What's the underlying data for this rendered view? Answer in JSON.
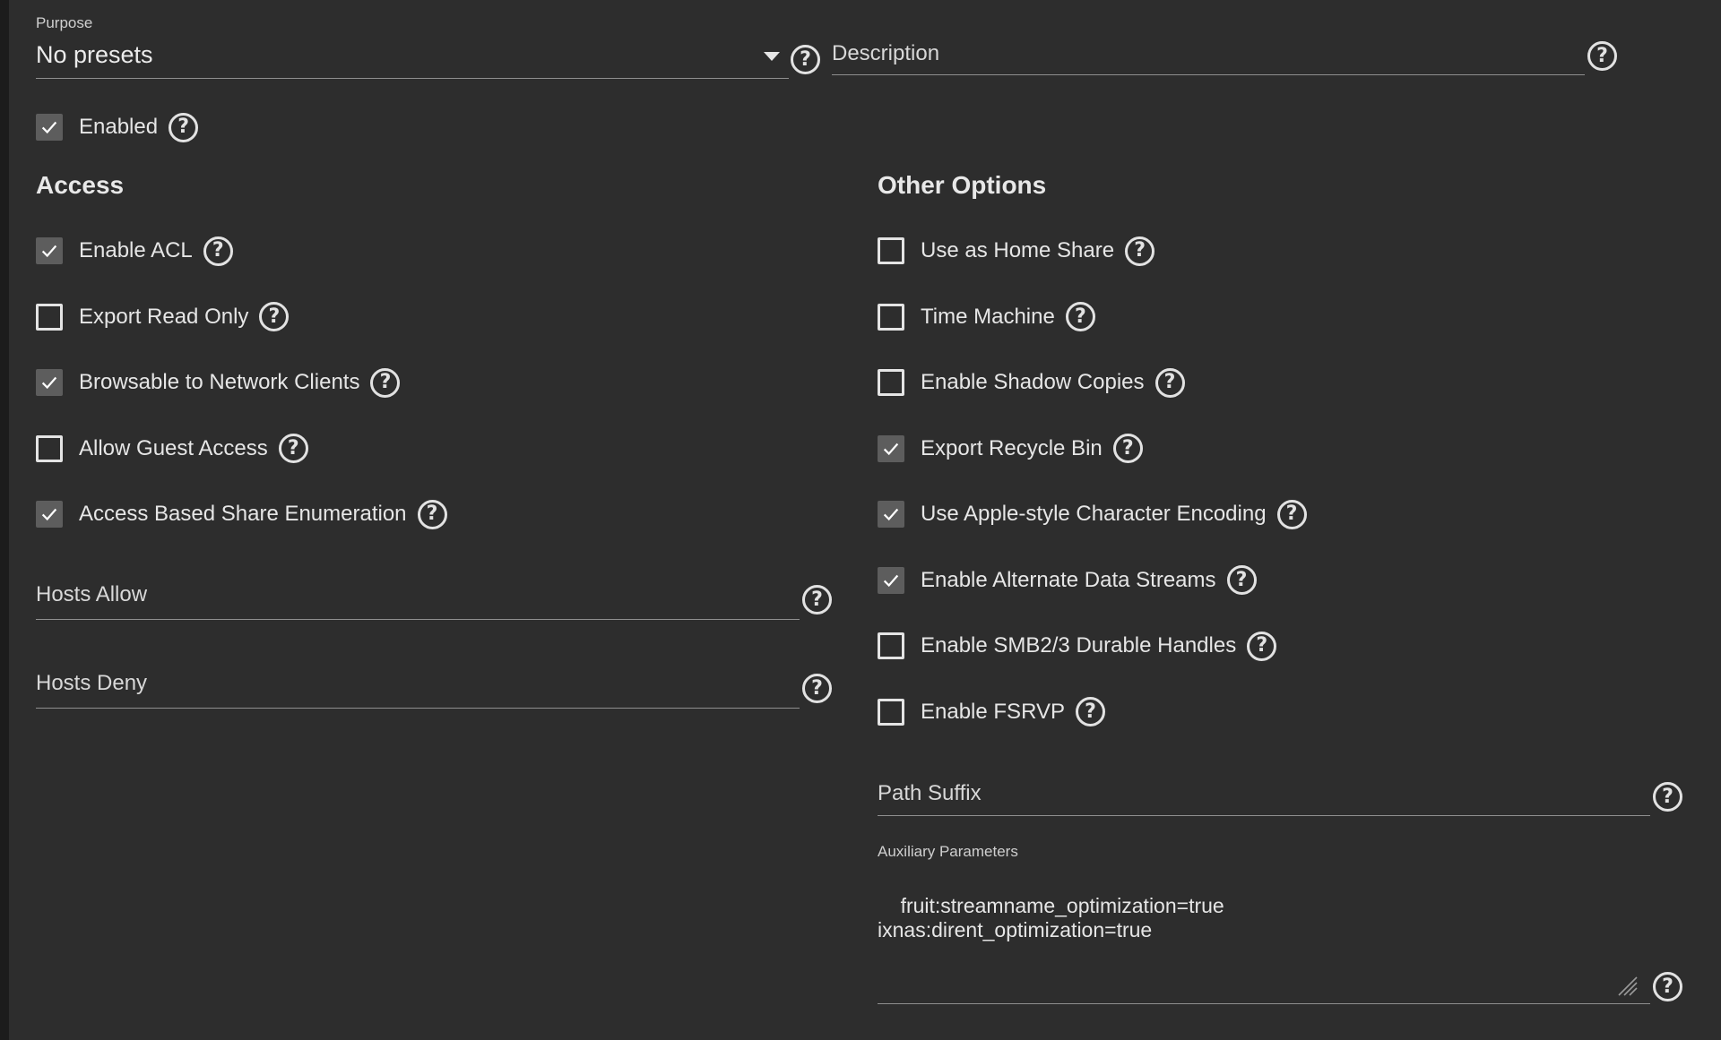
{
  "purpose": {
    "label": "Purpose",
    "value": "No presets"
  },
  "description": {
    "placeholder": "Description"
  },
  "enabled": {
    "label": "Enabled",
    "checked": true
  },
  "access": {
    "title": "Access",
    "options": [
      {
        "label": "Enable ACL",
        "checked": true
      },
      {
        "label": "Export Read Only",
        "checked": false
      },
      {
        "label": "Browsable to Network Clients",
        "checked": true
      },
      {
        "label": "Allow Guest Access",
        "checked": false
      },
      {
        "label": "Access Based Share Enumeration",
        "checked": true
      }
    ],
    "hosts_allow": {
      "placeholder": "Hosts Allow"
    },
    "hosts_deny": {
      "placeholder": "Hosts Deny"
    }
  },
  "other": {
    "title": "Other Options",
    "options": [
      {
        "label": "Use as Home Share",
        "checked": false
      },
      {
        "label": "Time Machine",
        "checked": false
      },
      {
        "label": "Enable Shadow Copies",
        "checked": false
      },
      {
        "label": "Export Recycle Bin",
        "checked": true
      },
      {
        "label": "Use Apple-style Character Encoding",
        "checked": true
      },
      {
        "label": "Enable Alternate Data Streams",
        "checked": true
      },
      {
        "label": "Enable SMB2/3 Durable Handles",
        "checked": false
      },
      {
        "label": "Enable FSRVP",
        "checked": false
      }
    ],
    "path_suffix": {
      "placeholder": "Path Suffix"
    },
    "aux": {
      "label": "Auxiliary Parameters",
      "value": "fruit:streamname_optimization=true\nixnas:dirent_optimization=true"
    }
  },
  "colors": {
    "background": "#2d2d2d",
    "checkbox_checked": "#5d5d5d",
    "text": "#e6e6e6"
  },
  "icons": {
    "help": "help-circle-icon",
    "check": "check-icon",
    "caret": "caret-down-icon"
  }
}
